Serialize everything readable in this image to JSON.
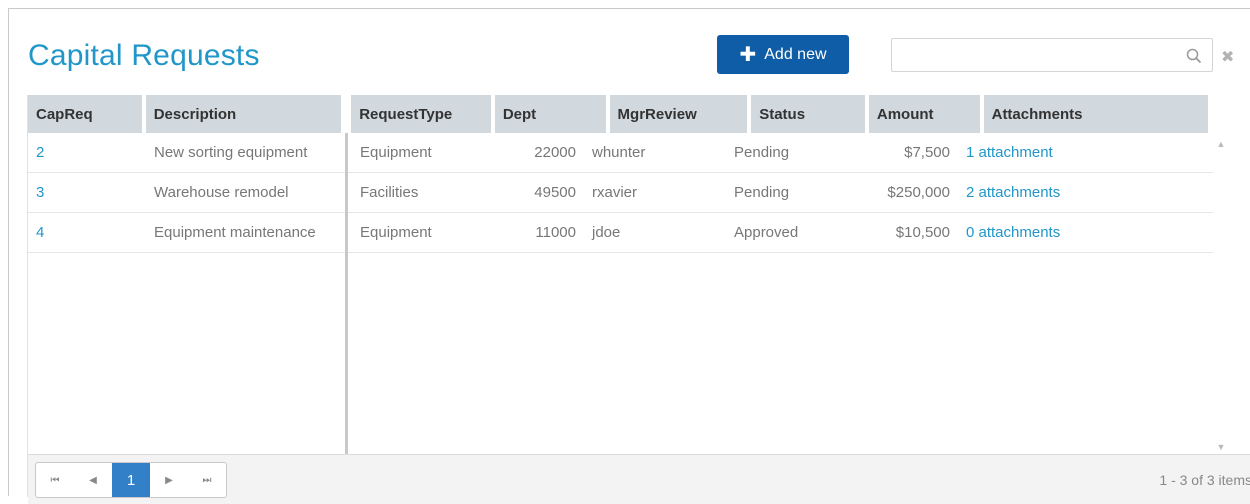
{
  "header": {
    "title": "Capital Requests",
    "add_label": "Add new",
    "add_icon": "plus-icon",
    "search_placeholder": "",
    "search_value": ""
  },
  "grid": {
    "columns": [
      "CapReq",
      "Description",
      "RequestType",
      "Dept",
      "MgrReview",
      "Status",
      "Amount",
      "Attachments"
    ],
    "rows": [
      {
        "capreq": "2",
        "description": "New sorting equipment",
        "requesttype": "Equipment",
        "dept": "22000",
        "mgrreview": "whunter",
        "status": "Pending",
        "amount": "$7,500",
        "attachments": "1 attachment"
      },
      {
        "capreq": "3",
        "description": "Warehouse remodel",
        "requesttype": "Facilities",
        "dept": "49500",
        "mgrreview": "rxavier",
        "status": "Pending",
        "amount": "$250,000",
        "attachments": "2 attachments"
      },
      {
        "capreq": "4",
        "description": "Equipment maintenance",
        "requesttype": "Equipment",
        "dept": "11000",
        "mgrreview": "jdoe",
        "status": "Approved",
        "amount": "$10,500",
        "attachments": "0 attachments"
      }
    ]
  },
  "pager": {
    "current_page": "1",
    "info": "1 - 3 of 3 items"
  },
  "colors": {
    "title": "#2196c9",
    "button": "#0f5da6",
    "header_bg": "#d1d8de",
    "link": "#2196c9",
    "active_page": "#3281c8"
  }
}
